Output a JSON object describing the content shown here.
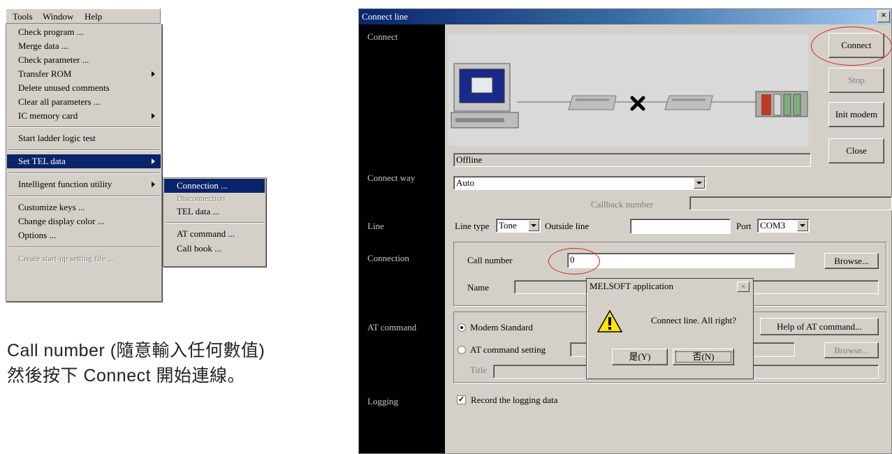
{
  "menubar": {
    "tools": "Tools",
    "window": "Window",
    "help": "Help"
  },
  "tools_menu": {
    "items": [
      "Check program ...",
      "Merge data ...",
      "Check parameter ...",
      "Transfer ROM",
      "Delete unused comments",
      "Clear all parameters ...",
      "IC memory card",
      "Start ladder logic test",
      "Set TEL data",
      "Intelligent function utility",
      "Customize keys ...",
      "Change display color ...",
      "Options ...",
      "Create start-up setting file ..."
    ]
  },
  "tel_submenu": {
    "items": [
      "Connection ...",
      "Disconnection",
      "TEL data ...",
      "AT command ...",
      "Call book ..."
    ]
  },
  "caption": {
    "line1": "Call number (隨意輸入任何數值)",
    "line2": "然後按下 Connect 開始連線。"
  },
  "dialog": {
    "title": "Connect line",
    "close": "×",
    "labels": {
      "connect": "Connect",
      "connect_way": "Connect way",
      "line": "Line",
      "connection": "Connection",
      "at_command": "AT command",
      "logging": "Logging"
    },
    "buttons": {
      "connect": "Connect",
      "stop": "Stop",
      "init_modem": "Init modem",
      "close": "Close",
      "browse": "Browse...",
      "help_at": "Help of AT command...",
      "browse2": "Browse..."
    },
    "status": "Offline",
    "connect_way_value": "Auto",
    "callback_number_label": "Callback number",
    "line_type_label": "Line type",
    "line_type_value": "Tone",
    "outside_line_label": "Outside line",
    "port_label": "Port",
    "port_value": "COM3",
    "call_number_label": "Call number",
    "call_number_value": "0",
    "name_label": "Name",
    "modem_standard": "Modem Standard",
    "at_command_setting": "AT command setting",
    "title_label": "Title",
    "record_logging": "Record the logging data"
  },
  "message_box": {
    "title": "MELSOFT application",
    "close": "×",
    "text": "Connect line.  All right?",
    "yes": "是(Y)",
    "no": "否(N)"
  }
}
